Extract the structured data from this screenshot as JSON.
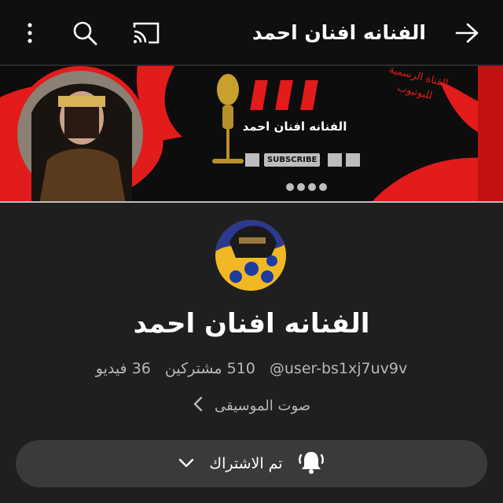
{
  "header": {
    "title": "الفنانه افنان احمد",
    "back_icon": "arrow-right-icon",
    "cast_icon": "cast-icon",
    "search_icon": "search-icon",
    "more_icon": "more-vertical-icon"
  },
  "banner": {
    "channel_name": "الفنانه افنان احمد",
    "official_text": "القناة الرسمية للبوتيوب",
    "subscribe_label": "SUBSCRIBE",
    "colors": {
      "accent": "#e21b1b",
      "background": "#0d0d0d"
    }
  },
  "channel": {
    "name": "الفنانه افنان احمد",
    "handle": "@user-bs1xj7uv9v",
    "subscribers": "510 مشتركين",
    "videos": "36 فيديو",
    "category": "صوت الموسيقى",
    "category_icon": "chevron-left-icon"
  },
  "subscribe_button": {
    "label": "تم الاشتراك",
    "bell_icon": "bell-ringing-icon",
    "chevron_icon": "chevron-down-icon"
  }
}
